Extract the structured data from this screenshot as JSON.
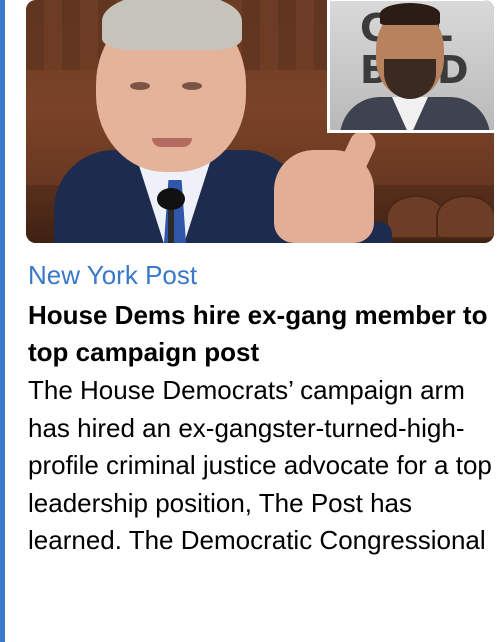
{
  "article": {
    "source": "New York Post",
    "headline": "House Dems hire ex-gang member to top campaign post",
    "summary": "The House Democrats’ campaign arm has hired an ex-gangster-turned-high-profile criminal justice advocate for a top leadership position, The Post has learned. The Democratic Congressional",
    "image": {
      "inset_text_line1": "C LL",
      "inset_text_line2": "B ND"
    }
  },
  "colors": {
    "accent": "#3a78c9",
    "source_text": "#3a78c9",
    "body_text": "#000000"
  }
}
